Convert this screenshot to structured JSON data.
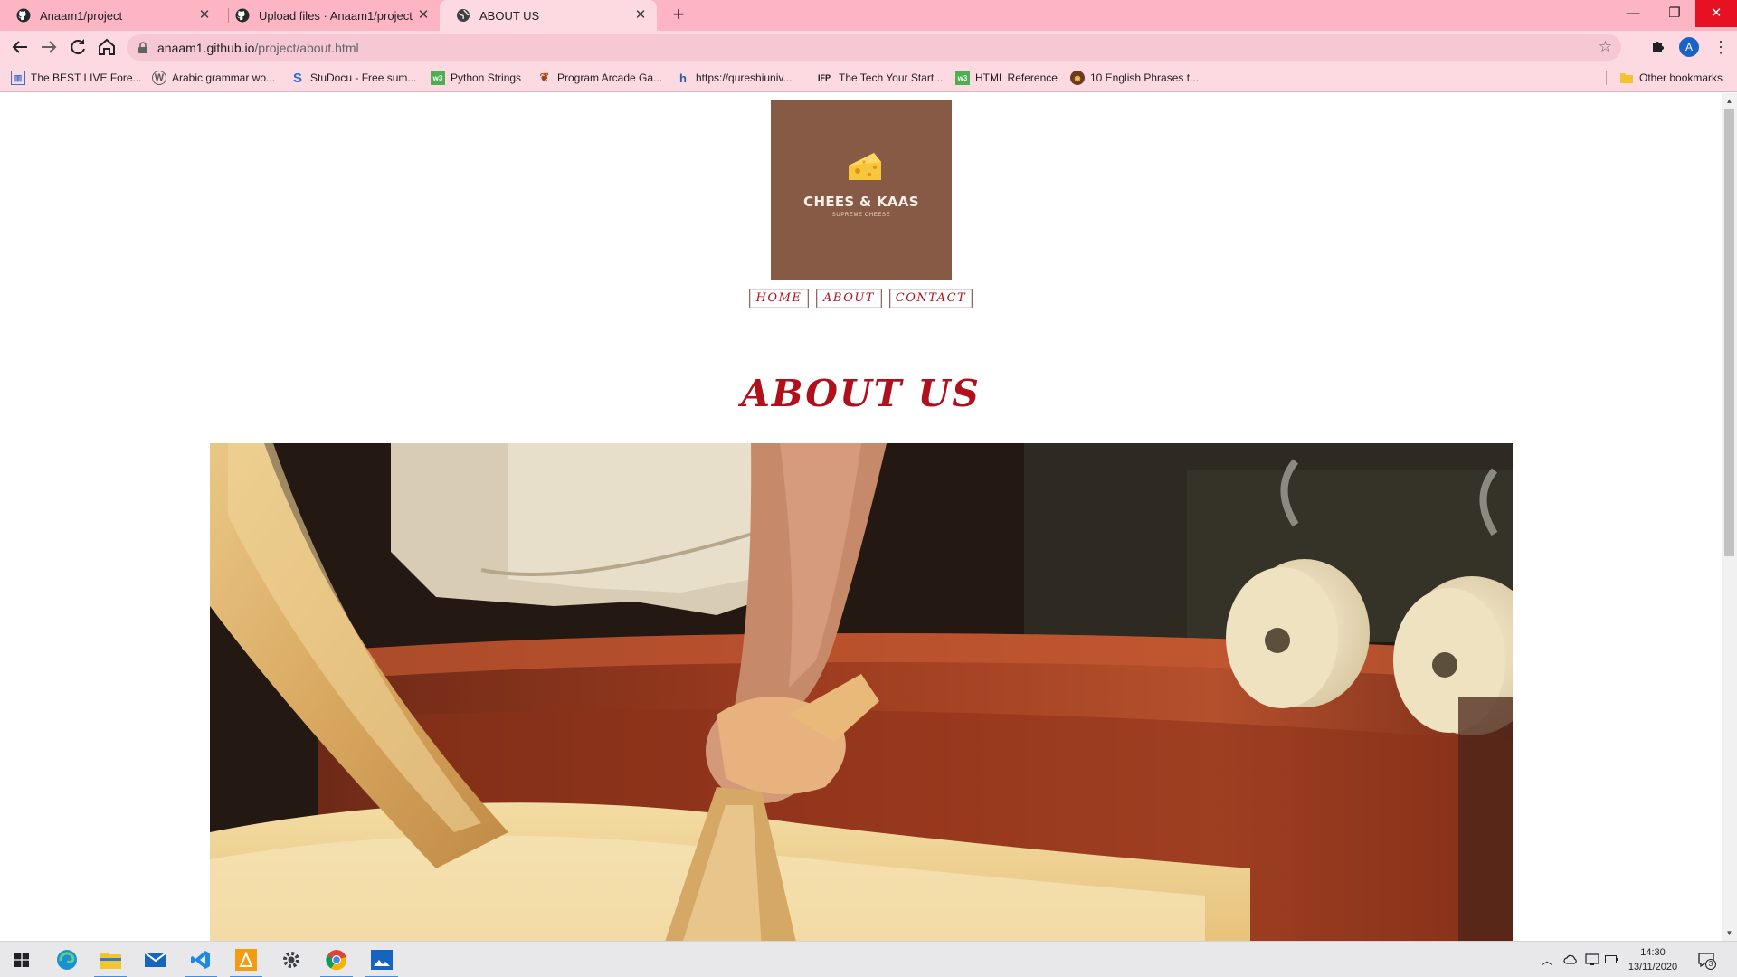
{
  "browser": {
    "tabs": [
      {
        "title": "Anaam1/project",
        "icon": "github-icon",
        "active": false
      },
      {
        "title": "Upload files · Anaam1/project",
        "icon": "github-icon",
        "active": false
      },
      {
        "title": "ABOUT US",
        "icon": "globe-icon",
        "active": true
      }
    ],
    "url_host": "anaam1.github.io",
    "url_path": "/project/about.html",
    "profile_initial": "A",
    "bookmarks": [
      {
        "label": "The BEST LIVE Fore...",
        "icon": "chart-icon"
      },
      {
        "label": "Arabic grammar wo...",
        "icon": "wordpress-icon"
      },
      {
        "label": "StuDocu - Free sum...",
        "icon": "studocu-icon"
      },
      {
        "label": "Python Strings",
        "icon": "w3schools-icon"
      },
      {
        "label": "Program Arcade Ga...",
        "icon": "leaf-icon"
      },
      {
        "label": "https://qureshiuniv...",
        "icon": "hm-icon"
      },
      {
        "label": "The Tech Your Start...",
        "icon": "ifp-icon"
      },
      {
        "label": "HTML Reference",
        "icon": "w3schools-icon"
      },
      {
        "label": "10 English Phrases t...",
        "icon": "owl-icon"
      }
    ],
    "other_bookmarks": "Other bookmarks"
  },
  "page": {
    "logo": {
      "brand": "CHEES & KAAS",
      "tagline": "SUPREME CHEESE",
      "icon": "cheese-icon",
      "bg_color": "#875a45"
    },
    "nav": [
      "HOME",
      "ABOUT",
      "CONTACT"
    ],
    "heading": "ABOUT US",
    "accent_color": "#b0101b",
    "hero_image": "cheesemaker-hands-cheesecloth-photo"
  },
  "taskbar": {
    "apps": [
      "windows-start-icon",
      "edge-icon",
      "file-explorer-icon",
      "mail-icon",
      "vscode-icon",
      "app-orange-icon",
      "settings-icon",
      "chrome-icon",
      "photos-icon"
    ],
    "time": "14:30",
    "date": "13/11/2020",
    "notification_count": "3"
  }
}
